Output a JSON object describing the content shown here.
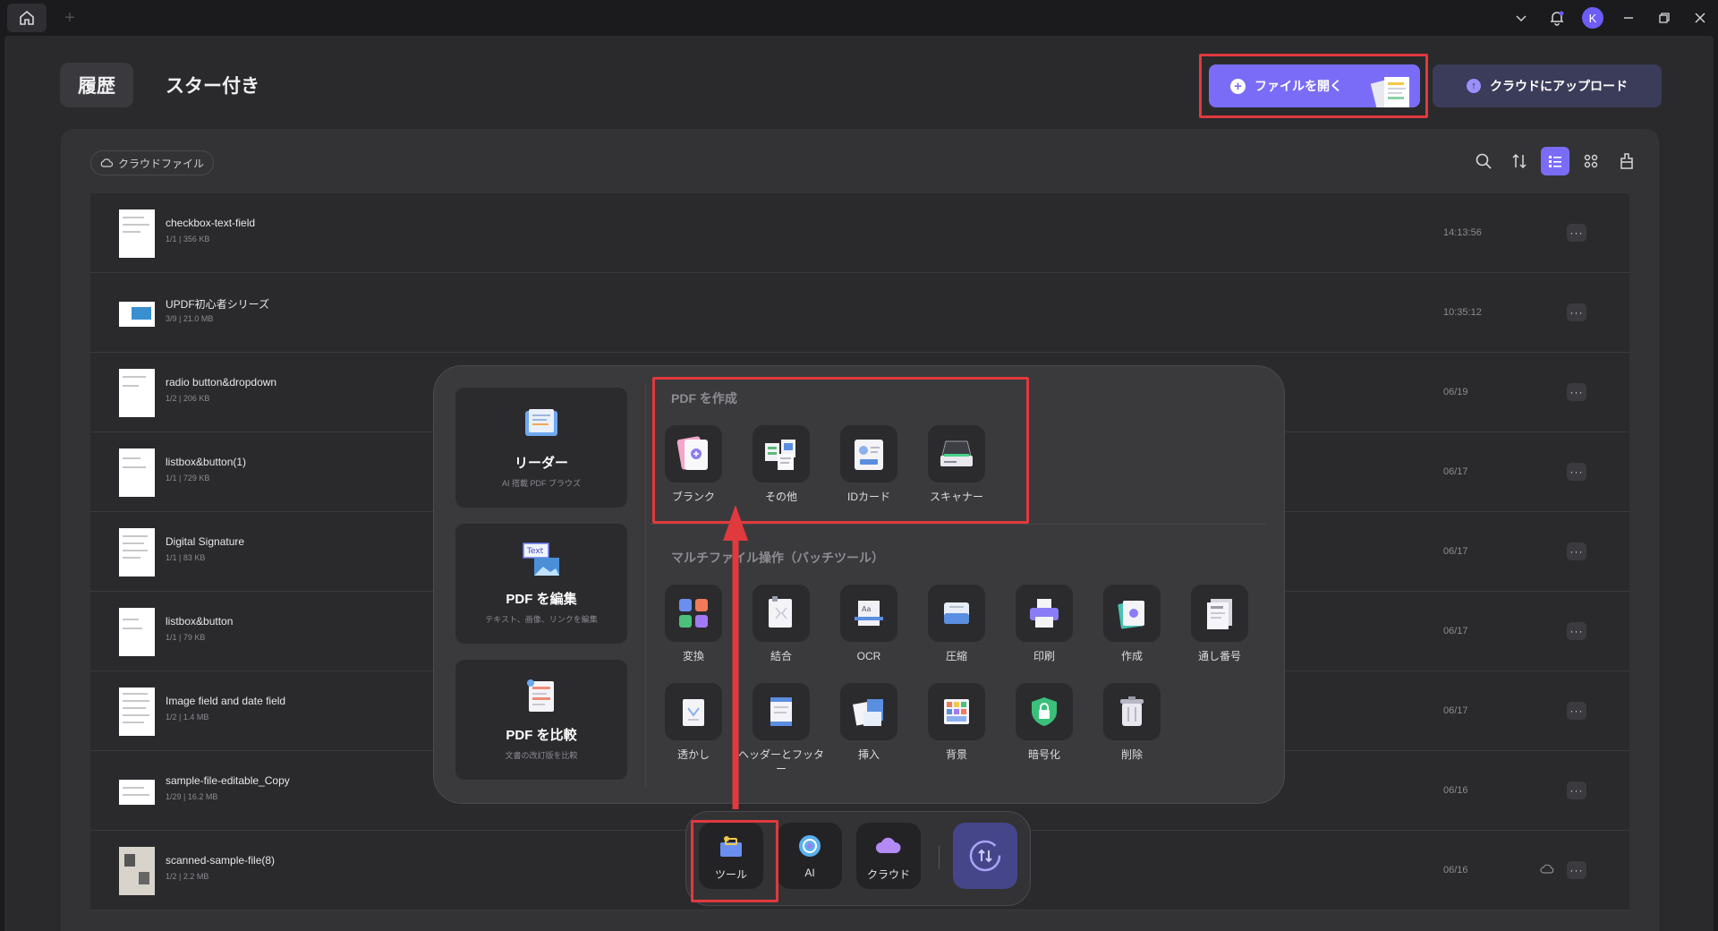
{
  "main": {
    "tabs": [
      {
        "label": "履歴"
      },
      {
        "label": "スター付き"
      }
    ],
    "open_file_label": "ファイルを開く",
    "upload_label": "クラウドにアップロード",
    "cloud_chip_label": "クラウドファイル"
  },
  "titlebar": {
    "avatar_letter": "K"
  },
  "files": [
    {
      "name": "checkbox-text-field",
      "meta": "1/1 | 356 KB",
      "time": "14:13:56"
    },
    {
      "name": "UPDF初心者シリーズ",
      "meta": "3/9 | 21.0 MB",
      "time": "10:35:12"
    },
    {
      "name": "radio button&dropdown",
      "meta": "1/2 | 206 KB",
      "time": "06/19"
    },
    {
      "name": "listbox&button(1)",
      "meta": "1/1 | 729 KB",
      "time": "06/17"
    },
    {
      "name": "Digital Signature",
      "meta": "1/1 | 83 KB",
      "time": "06/17"
    },
    {
      "name": "listbox&button",
      "meta": "1/1 | 79 KB",
      "time": "06/17"
    },
    {
      "name": "Image field and date field",
      "meta": "1/2 | 1.4 MB",
      "time": "06/17"
    },
    {
      "name": "sample-file-editable_Copy",
      "meta": "1/29 | 16.2 MB",
      "time": "06/16"
    },
    {
      "name": "scanned-sample-file(8)",
      "meta": "1/2 | 2.2 MB",
      "time": "06/16"
    }
  ],
  "popup": {
    "side": [
      {
        "title": "リーダー",
        "sub": "AI 搭載 PDF ブラウズ"
      },
      {
        "title": "PDF を編集",
        "sub": "テキスト、画像、リンクを編集"
      },
      {
        "title": "PDF を比較",
        "sub": "文書の改訂版を比較"
      }
    ],
    "create_title": "PDF を作成",
    "create_tools": [
      "ブランク",
      "その他",
      "IDカード",
      "スキャナー"
    ],
    "batch_title": "マルチファイル操作（バッチツール）",
    "batch_tools_row1": [
      "変換",
      "結合",
      "OCR",
      "圧縮",
      "印刷",
      "作成",
      "通し番号"
    ],
    "batch_tools_row2": [
      "透かし",
      "ヘッダーとフッター",
      "挿入",
      "背景",
      "暗号化",
      "削除"
    ]
  },
  "dock": {
    "tools_label": "ツール",
    "ai_label": "AI",
    "cloud_label": "クラウド"
  },
  "colors": {
    "accent": "#7b6cf7",
    "highlight": "#e0393e"
  }
}
